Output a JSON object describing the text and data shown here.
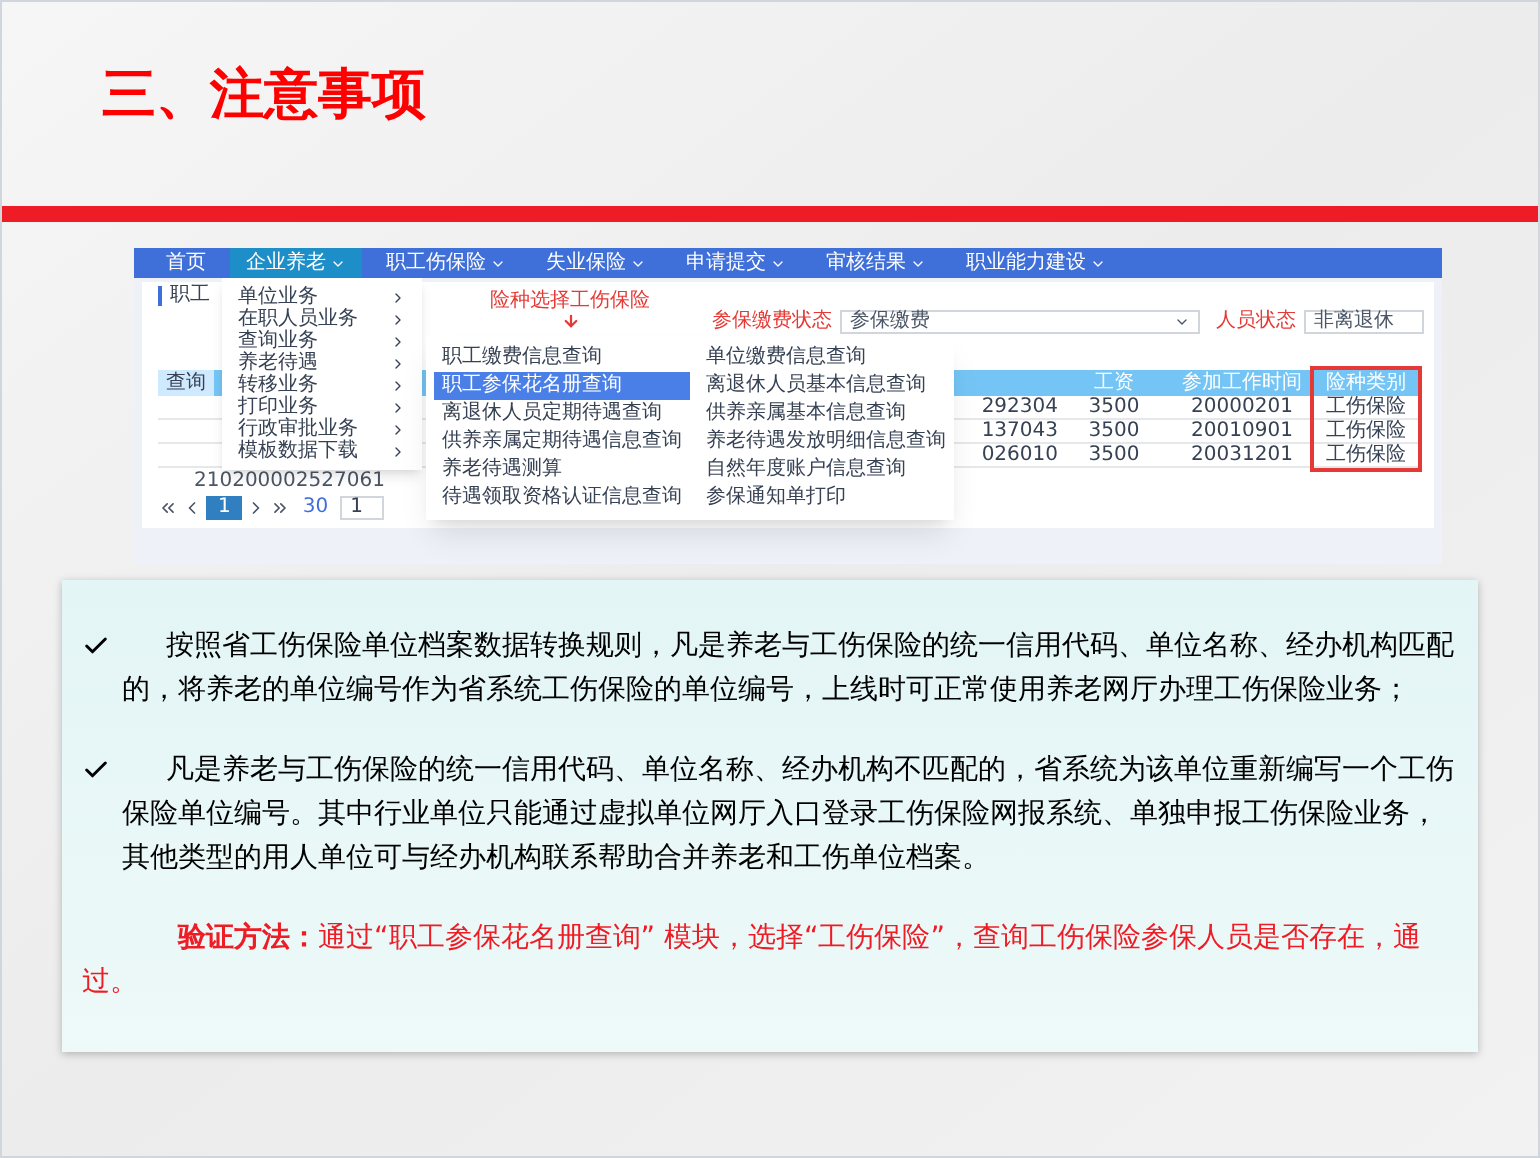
{
  "slide_title": "三、注意事项",
  "screenshot": {
    "nav": [
      {
        "label": "首页",
        "selected": false,
        "dropdown": false
      },
      {
        "label": "企业养老",
        "selected": true,
        "dropdown": true
      },
      {
        "label": "职工伤保险",
        "selected": false,
        "dropdown": true
      },
      {
        "label": "失业保险",
        "selected": false,
        "dropdown": true
      },
      {
        "label": "申请提交",
        "selected": false,
        "dropdown": true
      },
      {
        "label": "审核结果",
        "selected": false,
        "dropdown": true
      },
      {
        "label": "职业能力建设",
        "selected": false,
        "dropdown": true
      }
    ],
    "page_title": "职工",
    "filters": [
      {
        "label": "参保缴费状态",
        "value": "参保缴费"
      },
      {
        "label": "人员状态",
        "value": "非离退休"
      }
    ],
    "table": {
      "label": "查询",
      "columns": [
        {
          "title": "工资",
          "highlighted": false
        },
        {
          "title": "参加工作时间",
          "highlighted": false
        },
        {
          "title": "险种类别",
          "highlighted": true
        }
      ],
      "rows": [
        {
          "column_1": "292304",
          "cells": [
            "3500",
            "20000201",
            "工伤保险"
          ]
        },
        {
          "column_1": "137043",
          "cells": [
            "3500",
            "20010901",
            "工伤保险"
          ]
        },
        {
          "column_1": "026010",
          "cells": [
            "3500",
            "20031201",
            "工伤保险"
          ]
        }
      ]
    },
    "extra_id": "210200002527061",
    "pager": {
      "pages": [
        {
          "label": "1",
          "selected": true
        }
      ],
      "page_size": "30",
      "page_input": "1"
    },
    "menu": [
      "单位业务",
      "在职人员业务",
      "查询业务",
      "养老待遇",
      "转移业务",
      "打印业务",
      "行政审批业务",
      "模板数据下载"
    ],
    "submenu": [
      [
        {
          "label": "职工缴费信息查询",
          "selected": false
        },
        {
          "label": "职工参保花名册查询",
          "selected": true
        },
        {
          "label": "离退休人员定期待遇查询",
          "selected": false
        },
        {
          "label": "供养亲属定期待遇信息查询",
          "selected": false
        },
        {
          "label": "养老待遇测算",
          "selected": false
        },
        {
          "label": "待遇领取资格认证信息查询",
          "selected": false
        }
      ],
      [
        {
          "label": "单位缴费信息查询",
          "selected": false
        },
        {
          "label": "离退休人员基本信息查询",
          "selected": false
        },
        {
          "label": "供养亲属基本信息查询",
          "selected": false
        },
        {
          "label": "养老待遇发放明细信息查询",
          "selected": false
        },
        {
          "label": "自然年度账户信息查询",
          "selected": false
        },
        {
          "label": "参保通知单打印",
          "selected": false
        }
      ]
    ],
    "annotation": "险种选择工伤保险"
  },
  "notes": [
    {
      "kind": "check",
      "text": "按照省工伤保险单位档案数据转换规则，凡是养老与工伤保险的统一信用代码、单位名称、经办机构匹配的，将养老的单位编号作为省系统工伤保险的单位编号，上线时可正常使用养老网厅办理工伤保险业务；"
    },
    {
      "kind": "check",
      "text": "凡是养老与工伤保险的统一信用代码、单位名称、经办机构不匹配的，省系统为该单位重新编写一个工伤保险单位编号。其中行业单位只能通过虚拟单位网厅入口登录工伤保险网报系统、单独申报工伤保险业务，其他类型的用人单位可与经办机构联系帮助合并养老和工伤单位档案。"
    },
    {
      "kind": "verify",
      "text": "**验证方法：**通过“职工参保花名册查询” 模块，选择“工伤保险”，查询工伤保险参保人员是否存在，通过。"
    }
  ]
}
